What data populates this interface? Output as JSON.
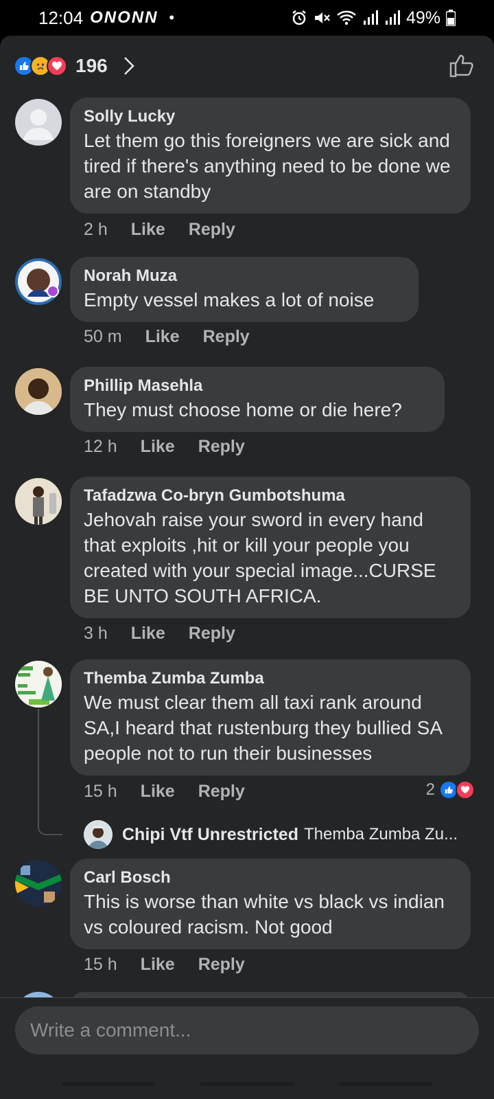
{
  "status_bar": {
    "time": "12:04",
    "notification_icons": "ONONN",
    "battery": "49%"
  },
  "reactions": {
    "count": "196"
  },
  "comments": [
    {
      "author": "Solly Lucky",
      "text": "Let them go this foreigners we are sick and tired if there's anything need to be done we are on standby",
      "time": "2 h",
      "like": "Like",
      "reply": "Reply"
    },
    {
      "author": "Norah Muza",
      "text": "Empty vessel makes a lot of noise",
      "time": "50 m",
      "like": "Like",
      "reply": "Reply"
    },
    {
      "author": "Phillip Masehla",
      "text": "They must choose home or die here?",
      "time": "12 h",
      "like": "Like",
      "reply": "Reply"
    },
    {
      "author": "Tafadzwa Co-bryn Gumbotshuma",
      "text": "Jehovah raise your sword in every hand that exploits ,hit or kill your people you created with your special image...CURSE BE UNTO SOUTH AFRICA.",
      "time": "3 h",
      "like": "Like",
      "reply": "Reply"
    },
    {
      "author": "Themba Zumba Zumba",
      "text": "We must clear them all taxi rank around SA,I heard that rustenburg they bullied SA people not to run their businesses",
      "time": "15 h",
      "like": "Like",
      "reply": "Reply",
      "reaction_count": "2",
      "reply_preview": {
        "author": "Chipi Vtf Unrestricted",
        "text": "Themba Zumba Zu..."
      }
    },
    {
      "author": "Carl Bosch",
      "text": "This is worse than white vs black vs indian vs coloured racism. Not good",
      "time": "15 h",
      "like": "Like",
      "reply": "Reply"
    }
  ],
  "composer": {
    "placeholder": "Write a comment..."
  },
  "colors": {
    "background": "#242526",
    "bubble": "#3a3b3c",
    "like_blue": "#1877f2",
    "love_red": "#f33e58",
    "sad_yellow": "#f7b125"
  }
}
